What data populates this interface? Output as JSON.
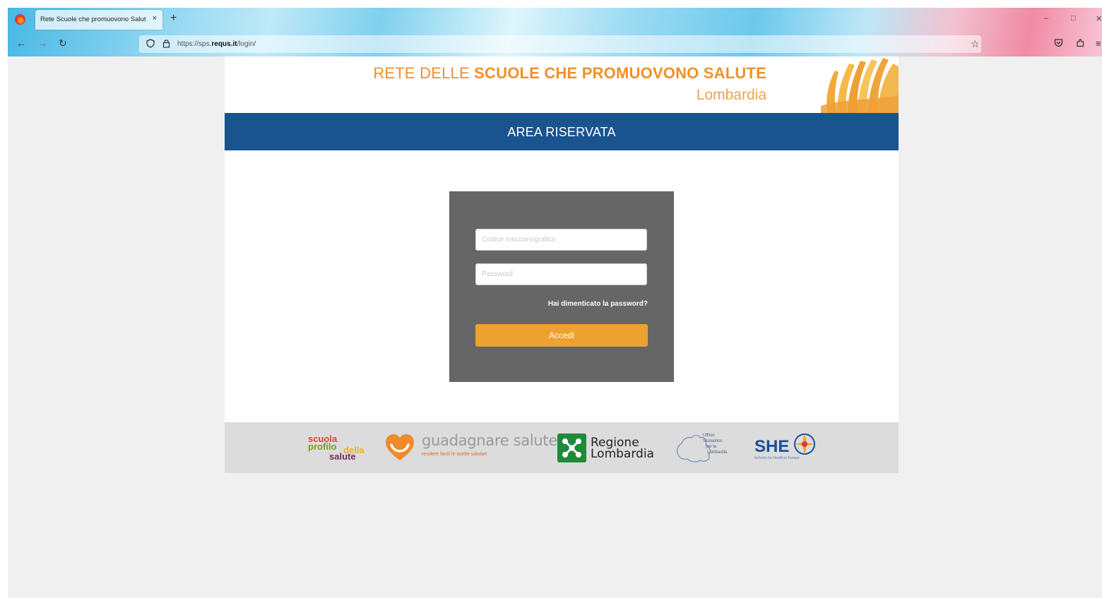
{
  "browser": {
    "tab_title": "Rete Scuole che promuovono Salut",
    "tab_close": "×",
    "new_tab": "+",
    "url_prefix": "https://sps.",
    "url_domain": "requs.it",
    "url_path": "/login/",
    "icons": [
      "firefox-logo",
      "back-arrow",
      "forward-arrow",
      "reload",
      "shield",
      "lock",
      "star",
      "pocket",
      "extensions",
      "menu",
      "minimize",
      "maximize",
      "close"
    ]
  },
  "header": {
    "title_normal": "RETE DELLE ",
    "title_strong": "SCUOLE CHE PROMUOVONO SALUTE",
    "subtitle": "Lombardia",
    "title_color": "#f0902a"
  },
  "banner": {
    "label": "AREA RISERVATA",
    "color": "#1a548f"
  },
  "login": {
    "code_placeholder": "Codice meccanografico",
    "password_placeholder": "Password",
    "forgot_label": "Hai dimenticato la password?",
    "submit_label": "Accedi",
    "box_color": "#666666",
    "button_color": "#efa12f"
  },
  "footer": {
    "logo1": {
      "line1": "scuola",
      "line2": "profilo",
      "line3": "della",
      "line4": "salute"
    },
    "logo2": {
      "title": "guadagnare salute",
      "tagline": "rendere facili le scelte salutari"
    },
    "logo3": {
      "line1": "Regione",
      "line2": "Lombardia"
    },
    "logo4": {
      "line1": "Ufficio",
      "line2": "Scolastico",
      "line3": "per la",
      "line4": "Lombardia"
    },
    "logo5": {
      "title": "SHE",
      "tagline": "Schools for Health in Europe"
    }
  }
}
